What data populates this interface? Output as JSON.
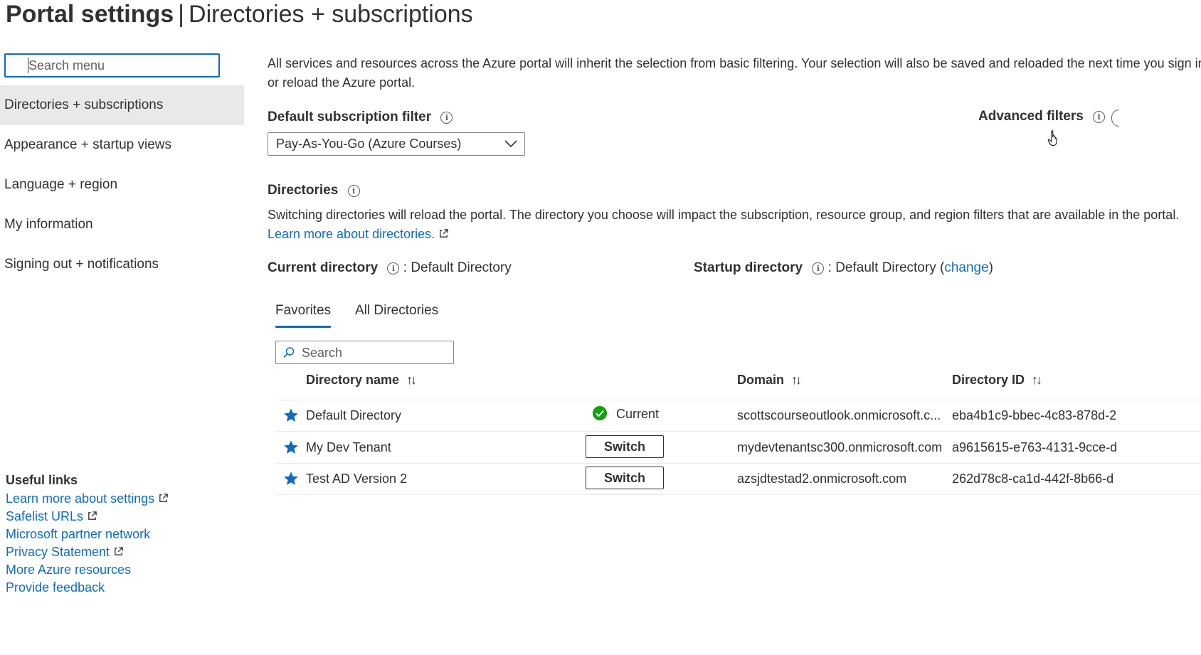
{
  "header": {
    "title_bold": "Portal settings",
    "separator": "|",
    "title_section": "Directories + subscriptions"
  },
  "sidebar": {
    "search_placeholder": "Search menu",
    "items": [
      {
        "label": "Directories + subscriptions",
        "selected": true
      },
      {
        "label": "Appearance + startup views",
        "selected": false
      },
      {
        "label": "Language + region",
        "selected": false
      },
      {
        "label": "My information",
        "selected": false
      },
      {
        "label": "Signing out + notifications",
        "selected": false
      }
    ],
    "useful_links_title": "Useful links",
    "useful_links": [
      {
        "label": "Learn more about settings",
        "external": true
      },
      {
        "label": "Safelist URLs",
        "external": true
      },
      {
        "label": "Microsoft partner network",
        "external": false
      },
      {
        "label": "Privacy Statement",
        "external": true
      },
      {
        "label": "More Azure resources",
        "external": false
      },
      {
        "label": "Provide feedback",
        "external": false
      }
    ]
  },
  "main": {
    "intro": "All services and resources across the Azure portal will inherit the selection from basic filtering. Your selection will also be saved and reloaded the next time you sign in or reload the Azure portal.",
    "default_filter_label": "Default subscription filter",
    "default_filter_value": "Pay-As-You-Go (Azure Courses)",
    "advanced_filters_label": "Advanced filters",
    "directories_label": "Directories",
    "directories_text": "Switching directories will reload the portal. The directory you choose will impact the subscription, resource group, and region filters that are available in the portal.",
    "directories_learn_more": "Learn more about directories.",
    "current_directory_label": "Current directory",
    "current_directory_value": ": Default Directory",
    "startup_directory_label": "Startup directory",
    "startup_directory_value": ": Default Directory (",
    "startup_change": "change",
    "startup_close": ")",
    "tabs": [
      {
        "label": "Favorites",
        "active": true
      },
      {
        "label": "All Directories",
        "active": false
      }
    ],
    "table_search_placeholder": "Search",
    "columns": {
      "name": "Directory name",
      "domain": "Domain",
      "id": "Directory ID",
      "sort_glyph": "↑↓"
    },
    "rows": [
      {
        "name": "Default Directory",
        "status": "Current",
        "action": "",
        "domain": "scottscourseoutlook.onmicrosoft.c...",
        "id": "eba4b1c9-bbec-4c83-878d-2"
      },
      {
        "name": "My Dev Tenant",
        "status": "",
        "action": "Switch",
        "domain": "mydevtenantsc300.onmicrosoft.com",
        "id": "a9615615-e763-4131-9cce-d"
      },
      {
        "name": "Test AD Version 2",
        "status": "",
        "action": "Switch",
        "domain": "azsjdtestad2.onmicrosoft.com",
        "id": "262d78c8-ca1d-442f-8b66-d"
      }
    ]
  },
  "colors": {
    "accent": "#0f6cbd",
    "selected_bg": "#e9e9e9",
    "success": "#13a10e",
    "star": "#0f6cbd"
  },
  "icons": {
    "info": "info-icon",
    "external": "external-link-icon",
    "chevron": "chevron-down-icon",
    "search": "search-icon",
    "star": "star-icon",
    "check": "check-circle-icon",
    "cursor": "hand-cursor-icon"
  }
}
